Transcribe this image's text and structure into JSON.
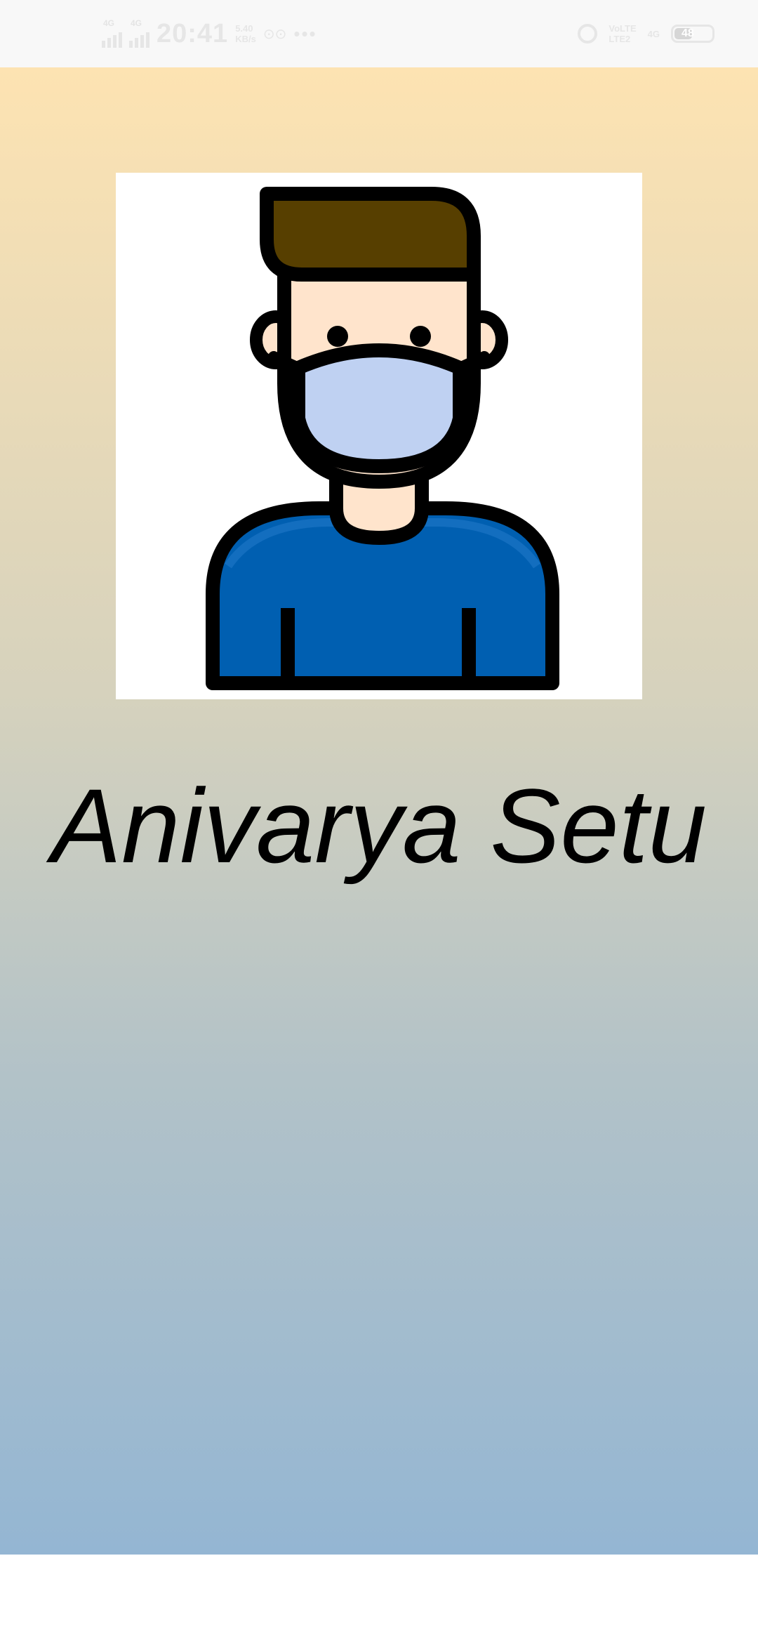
{
  "status_bar": {
    "network_left_1": "4G",
    "network_left_2": "4G",
    "time": "20:41",
    "speed_value": "5.40",
    "speed_unit": "KB/s",
    "extra_icon": "⊙⊙",
    "overflow": "•••",
    "alarm_icon": "alarm-icon",
    "volte_top": "VoLTE",
    "volte_bottom": "LTE2",
    "network_right": "4G",
    "battery_level": "48"
  },
  "splash": {
    "app_title": "Anivarya Setu",
    "avatar": "masked-person-icon"
  },
  "colors": {
    "gradient_top": "#fde3b2",
    "gradient_bottom": "#94b6d3",
    "hair": "#573f00",
    "skin": "#ffe4cc",
    "mask": "#bfd1f2",
    "shirt": "#005fb1"
  }
}
